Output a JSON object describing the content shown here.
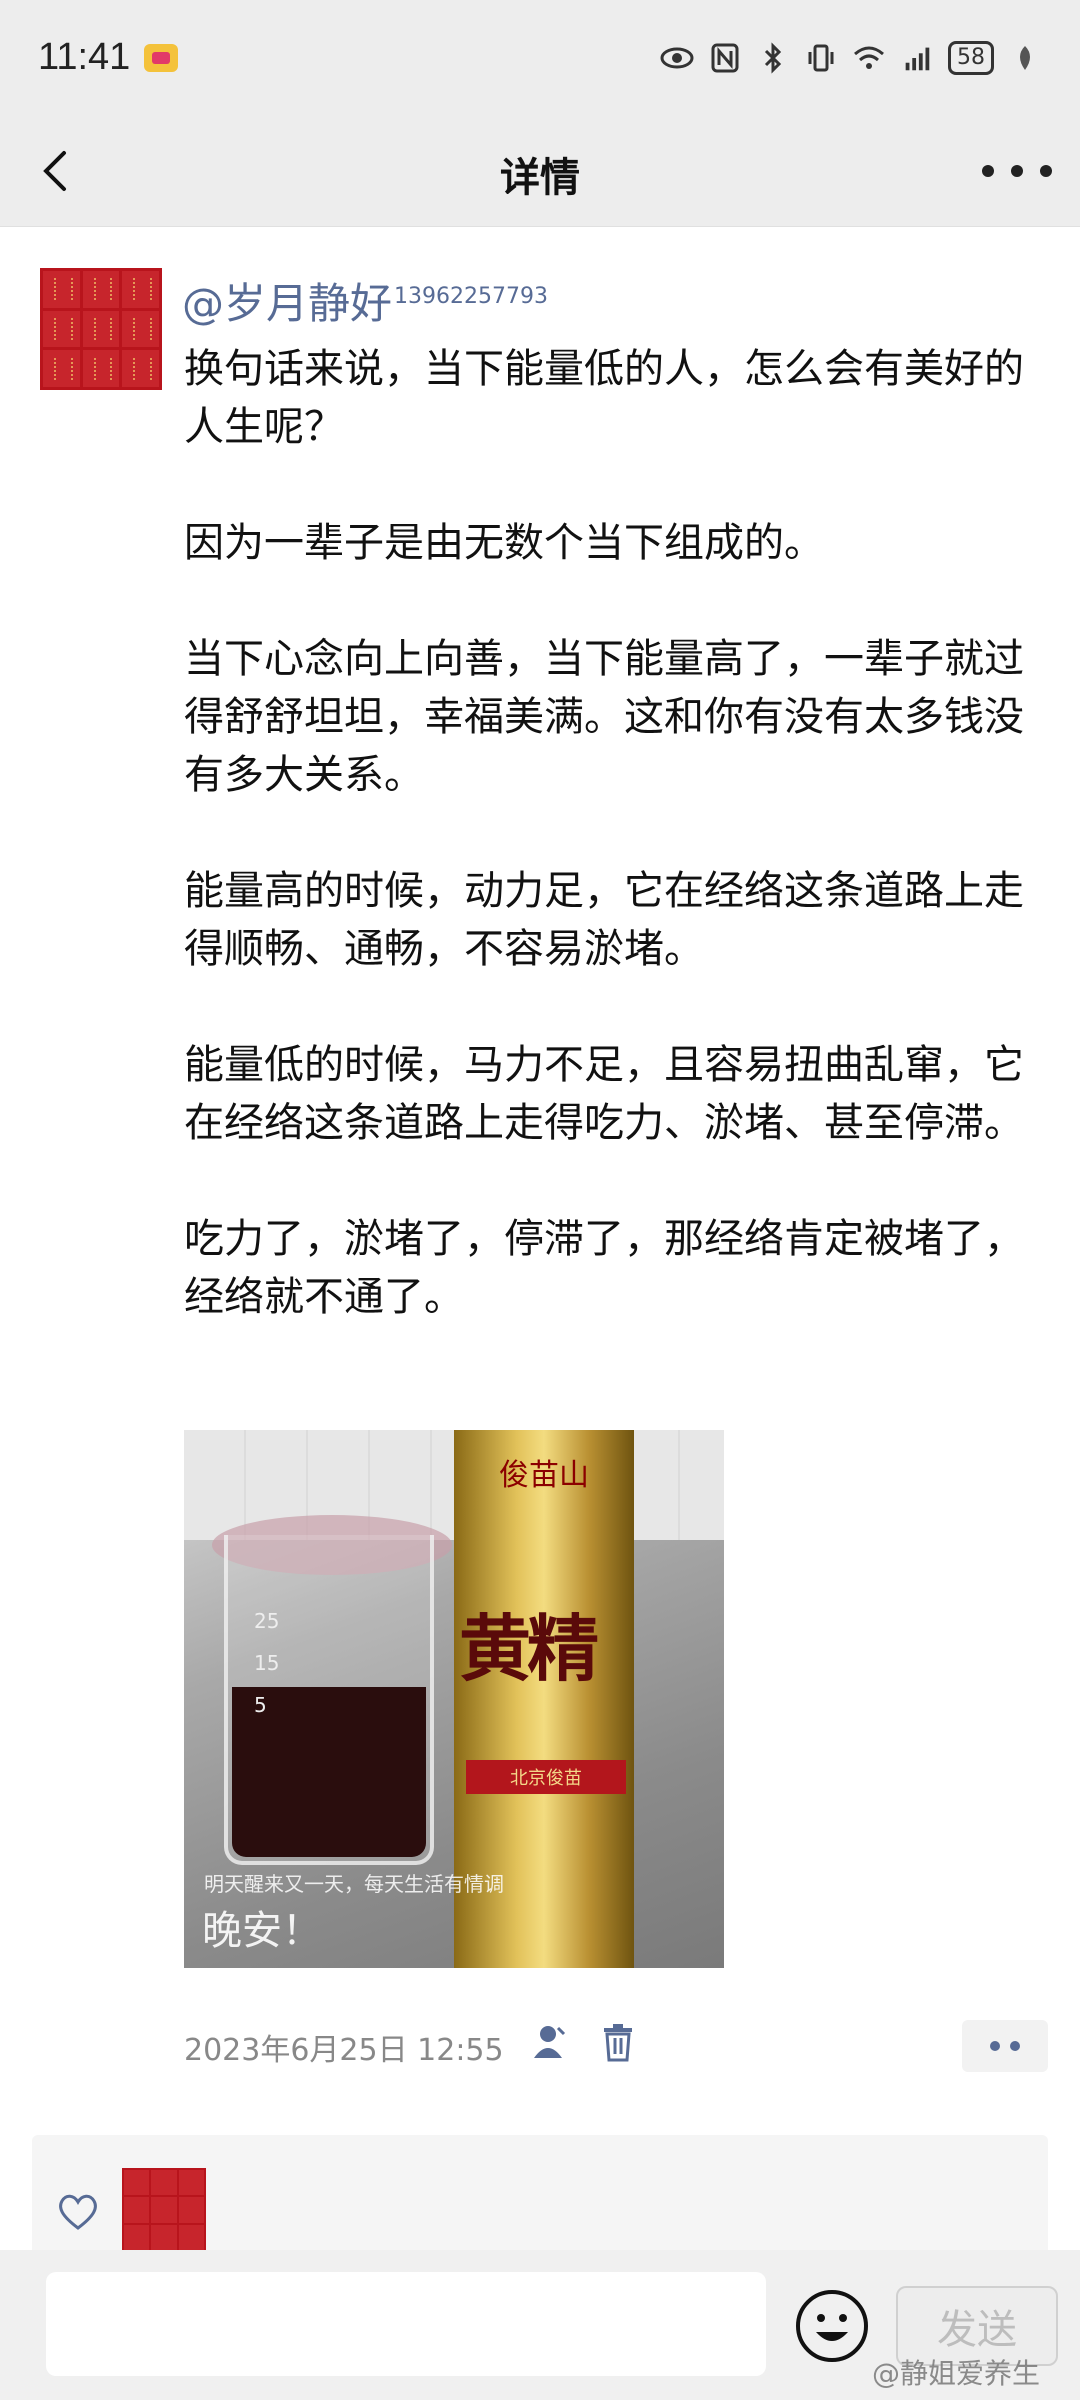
{
  "status_bar": {
    "time": "11:41",
    "battery": "58",
    "icons": [
      "eye-icon",
      "nfc-icon",
      "bluetooth-icon",
      "vibrate-icon",
      "wifi-icon",
      "signal-4g-icon",
      "battery-icon",
      "leaf-icon"
    ]
  },
  "header": {
    "title": "详情",
    "back_icon": "chevron-left-icon",
    "more_icon": "more-dots-icon"
  },
  "post": {
    "username": "@岁月静好",
    "username_suffix": "13962257793",
    "text": "换句话来说，当下能量低的人，怎么会有美好的人生呢？\n\n因为一辈子是由无数个当下组成的。\n\n当下心念向上向善，当下能量高了，一辈子就过得舒舒坦坦，幸福美满。这和你有没有太多钱没有多大关系。\n\n能量高的时候，动力足，它在经络这条道路上走得顺畅、通畅，不容易淤堵。\n\n能量低的时候，马力不足，且容易扭曲乱窜，它在经络这条道路上走得吃力、淤堵、甚至停滞。\n\n吃力了，淤堵了，停滞了，那经络肯定被堵了，经络就不通了。",
    "photo": {
      "bottle_brand": "俊苗山",
      "bottle_label": "黄精",
      "bottle_red_label": "北京俊苗",
      "beaker_marks": [
        "25",
        "15",
        "5"
      ],
      "caption_small": "明天醒来又一天，每天生活有情调",
      "caption_big": "晚安！"
    },
    "timestamp": "2023年6月25日 12:55"
  },
  "composer": {
    "placeholder": "",
    "send_label": "发送",
    "emoji_icon": "smile-emoji-icon"
  },
  "watermark": "@静姐爱养生",
  "colors": {
    "bar_bg": "#ededed",
    "link": "#576b95",
    "avatar_red": "#c7252c"
  }
}
